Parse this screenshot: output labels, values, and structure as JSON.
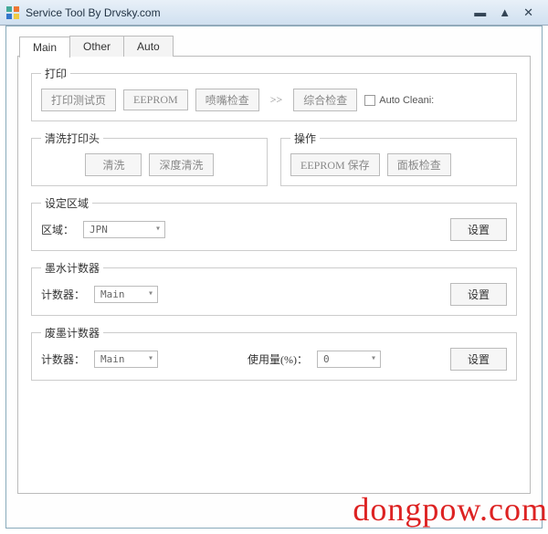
{
  "window": {
    "title": "Service Tool By Drvsky.com"
  },
  "tabs": {
    "main": "Main",
    "other": "Other",
    "auto": "Auto"
  },
  "print": {
    "legend": "打印",
    "btn_testpage": "打印测试页",
    "btn_eeprom": "EEPROM",
    "btn_nozzle": "喷嘴检查",
    "arrow": ">>",
    "btn_overall": "综合检查",
    "chk_autoclean": "Auto Cleani:"
  },
  "clean": {
    "legend": "清洗打印头",
    "btn_clean": "清洗",
    "btn_deep": "深度清洗"
  },
  "op": {
    "legend": "操作",
    "btn_eeprom_save": "EEPROM 保存",
    "btn_panel": "面板检查"
  },
  "region": {
    "legend": "设定区域",
    "lbl": "区域：",
    "value": "JPN",
    "btn_set": "设置"
  },
  "ink": {
    "legend": "墨水计数器",
    "lbl": "计数器：",
    "value": "Main",
    "btn_set": "设置"
  },
  "waste": {
    "legend": "废墨计数器",
    "lbl": "计数器：",
    "value": "Main",
    "usage_lbl": "使用量(%)：",
    "usage_value": "0",
    "btn_set": "设置"
  },
  "watermark": "dongpow.com"
}
